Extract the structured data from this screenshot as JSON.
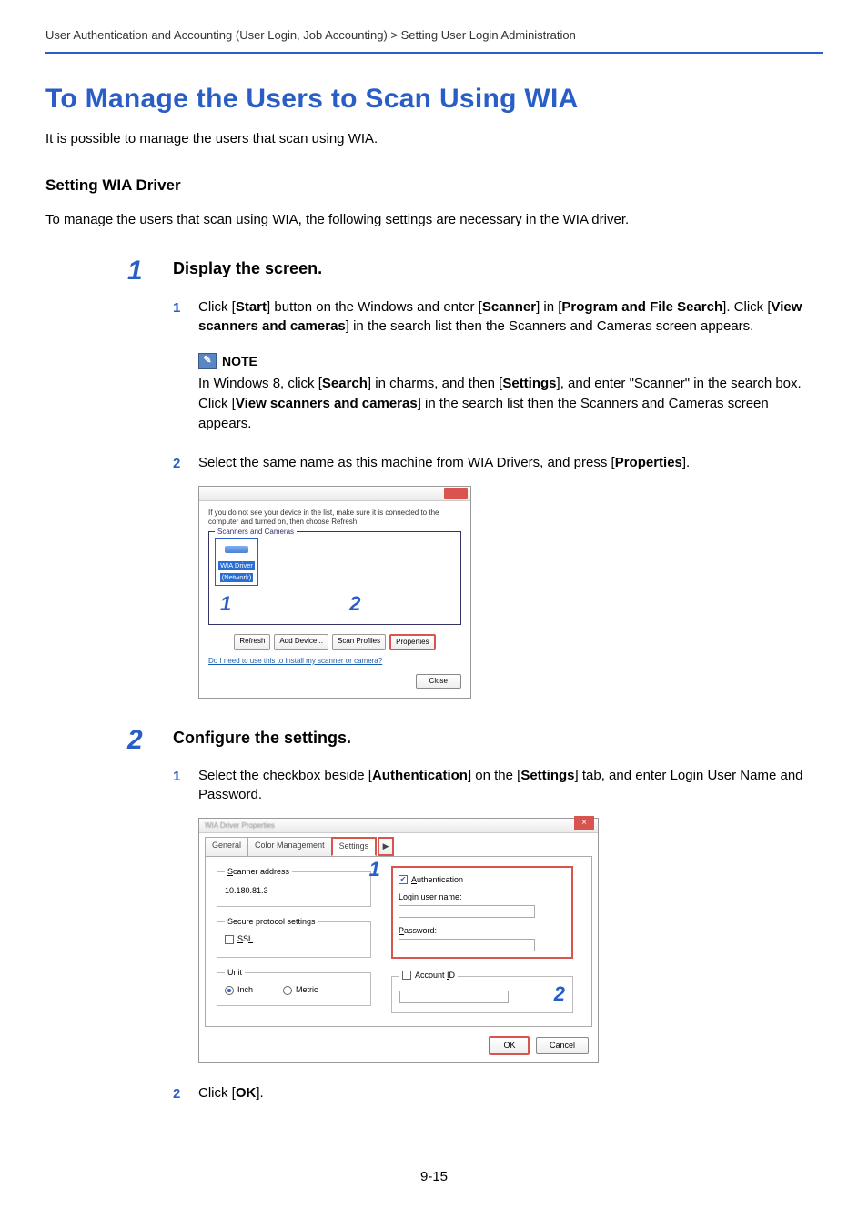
{
  "breadcrumb": "User Authentication and Accounting (User Login, Job Accounting) > Setting User Login Administration",
  "page_title": "To Manage the Users to Scan Using WIA",
  "intro": "It is possible to manage the users that scan using WIA.",
  "subsection_title": "Setting WIA Driver",
  "subsection_desc": "To manage the users that scan using WIA, the following settings are necessary in the WIA driver.",
  "step1": {
    "num": "1",
    "title": "Display the screen.",
    "sub1": {
      "num": "1",
      "t1": "Click [",
      "b1": "Start",
      "t2": "] button on the Windows and enter [",
      "b2": "Scanner",
      "t3": "] in [",
      "b3": "Program and File Search",
      "t4": "]. Click [",
      "b4": "View scanners and cameras",
      "t5": "] in the search list then the Scanners and Cameras screen appears."
    },
    "note": {
      "label": "NOTE",
      "t1": "In Windows 8, click [",
      "b1": "Search",
      "t2": "] in charms, and then [",
      "b2": "Settings",
      "t3": "], and enter \"Scanner\" in the search box. Click [",
      "b3": "View scanners and cameras",
      "t4": "] in the search list then the Scanners and Cameras screen appears."
    },
    "sub2": {
      "num": "2",
      "t1": "Select the same name as this machine from WIA Drivers, and press [",
      "b1": "Properties",
      "t2": "]."
    },
    "shot": {
      "hint": "If you do not see your device in the list, make sure it is connected to the computer and turned on, then choose Refresh.",
      "group_label": "Scanners and Cameras",
      "device_line1": "WIA Driver",
      "device_line2": "(Network)",
      "num1": "1",
      "num2": "2",
      "btn_refresh": "Refresh",
      "btn_add": "Add Device...",
      "btn_profiles": "Scan Profiles",
      "btn_properties": "Properties",
      "link": "Do I need to use this to install my scanner or camera?",
      "btn_close": "Close"
    }
  },
  "step2": {
    "num": "2",
    "title": "Configure the settings.",
    "sub1": {
      "num": "1",
      "t1": "Select the checkbox beside [",
      "b1": "Authentication",
      "t2": "] on the [",
      "b2": "Settings",
      "t3": "] tab, and enter Login User Name and Password."
    },
    "shot": {
      "title": "WIA Driver Properties",
      "tab_general": "General",
      "tab_color": "Color Management",
      "tab_settings": "Settings",
      "tab_overflow": "▶",
      "callout1": "1",
      "left": {
        "scanner_addr_label": "Scanner address",
        "scanner_addr_value": "10.180.81.3",
        "secure_label": "Secure protocol settings",
        "ssl_label": "SSL",
        "unit_label": "Unit",
        "unit_inch": "Inch",
        "unit_metric": "Metric"
      },
      "right": {
        "auth_label": "Authentication",
        "login_label": "Login user name:",
        "pass_label": "Password:",
        "account_label": "Account ID",
        "num2": "2"
      },
      "btn_ok": "OK",
      "btn_cancel": "Cancel"
    },
    "sub2": {
      "num": "2",
      "t1": "Click [",
      "b1": "OK",
      "t2": "]."
    }
  },
  "page_number": "9-15"
}
